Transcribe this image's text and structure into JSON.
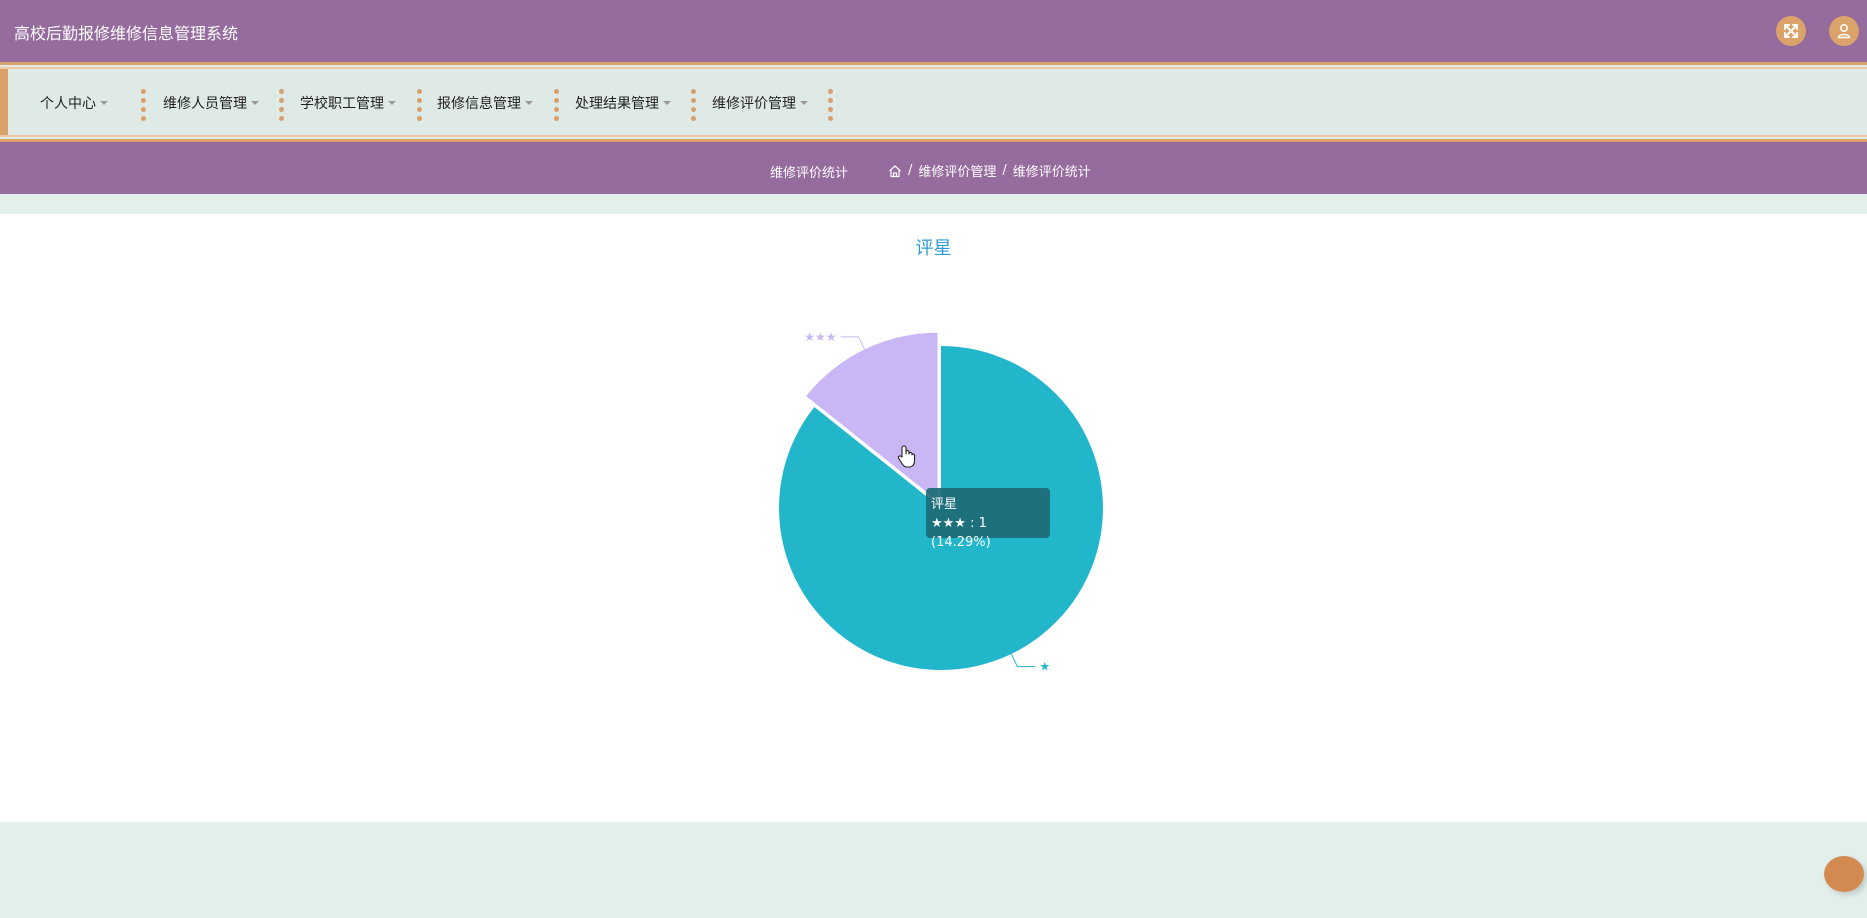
{
  "app": {
    "title": "高校后勤报修维修信息管理系统"
  },
  "header": {
    "fullscreen_icon": "fullscreen-icon",
    "user_icon": "user-icon",
    "accent_color": "#dba36a",
    "bar_color": "#966b9d"
  },
  "nav": {
    "items": [
      {
        "label": "个人中心"
      },
      {
        "label": "维修人员管理"
      },
      {
        "label": "学校职工管理"
      },
      {
        "label": "报修信息管理"
      },
      {
        "label": "处理结果管理"
      },
      {
        "label": "维修评价管理"
      }
    ]
  },
  "subheader": {
    "page_title": "维修评价统计",
    "breadcrumb": [
      {
        "label": "维修评价管理"
      },
      {
        "label": "维修评价统计"
      }
    ],
    "separator": "/",
    "home_icon": "home-icon"
  },
  "chart_data": {
    "type": "pie",
    "title": "评星",
    "series": [
      {
        "name": "评星",
        "data": [
          {
            "label": "★★★",
            "value": 1,
            "color": "#c9b6f4"
          },
          {
            "label": "★",
            "value": 6,
            "color": "#22b6cb"
          }
        ]
      }
    ]
  },
  "tooltip": {
    "title": "评星",
    "text": "★★★ : 1 (14.29%)"
  }
}
